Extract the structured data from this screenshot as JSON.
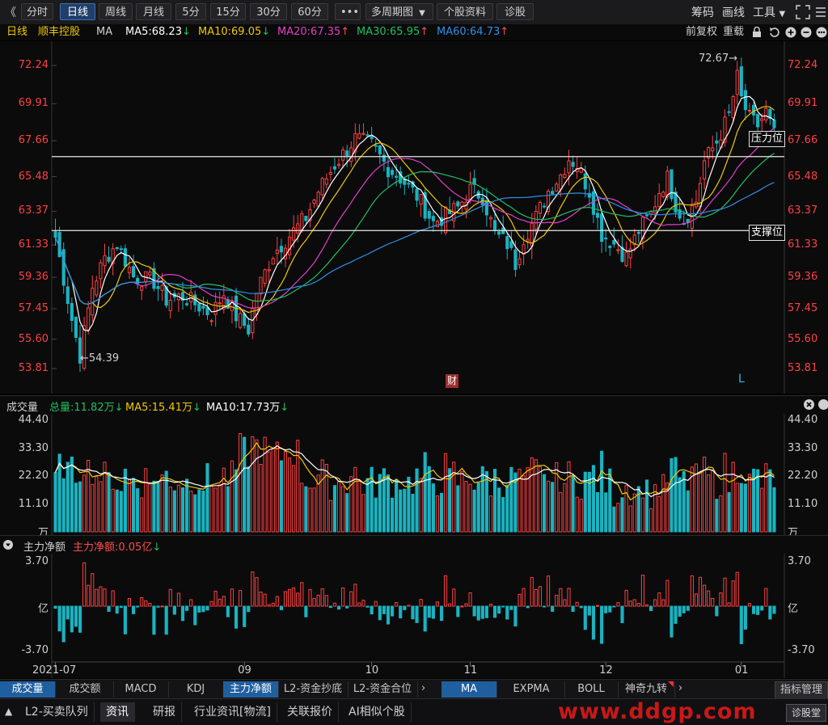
{
  "toolbar": {
    "back_glyph": "《",
    "buttons": [
      "分时",
      "日线",
      "周线",
      "月线",
      "5分",
      "15分",
      "30分",
      "60分",
      "•••",
      "多周期图",
      "个股资料",
      "诊股"
    ],
    "active": "日线",
    "multi_dropdown_glyph": "▼",
    "right": [
      "筹码",
      "画线",
      "工具"
    ],
    "tools_dropdown_glyph": "▼"
  },
  "info": {
    "period": "日线",
    "stock": "顺丰控股",
    "indicator": "MA",
    "ma5": "MA5:68.23",
    "ma10": "MA10:69.05",
    "ma20": "MA20:67.35",
    "ma30": "MA30:65.95",
    "ma60": "MA60:64.73",
    "fuquan": "前复权",
    "reload": "重载"
  },
  "colors": {
    "up": "#ff4040",
    "down": "#1ab3c0",
    "ma5": "#ffffff",
    "ma10": "#f0c800",
    "ma20": "#e040c8",
    "ma30": "#20c060",
    "ma60": "#2f8fe8",
    "grid": "#262626",
    "axis_red": "#ff4040"
  },
  "main": {
    "y_labels": [
      "72.24",
      "69.91",
      "67.66",
      "65.48",
      "63.37",
      "61.33",
      "59.36",
      "57.45",
      "55.60",
      "53.81"
    ],
    "y_range": [
      53.81,
      72.24
    ],
    "high_marker": "72.67→",
    "low_marker": "←54.39",
    "resistance_label": "压力位",
    "support_label": "支撑位",
    "resistance_value": 66.7,
    "support_value": 62.2,
    "cai_badge": "财",
    "l_badge": "L"
  },
  "volume": {
    "title": "成交量",
    "total": "总量:11.82万",
    "ma5": "MA5:15.41万",
    "ma10": "MA10:17.73万",
    "y_labels": [
      "44.40",
      "33.30",
      "22.20",
      "11.10",
      "万"
    ],
    "y_max": 44.4
  },
  "netflow": {
    "title": "主力净额",
    "value": "主力净额:0.05亿",
    "y_labels": [
      "3.70",
      "亿",
      "-3.70"
    ],
    "y_max": 3.7
  },
  "x_labels": [
    {
      "label": "2021-07",
      "bar": 0
    },
    {
      "label": "09",
      "bar": 46
    },
    {
      "label": "10",
      "bar": 77
    },
    {
      "label": "11",
      "bar": 101
    },
    {
      "label": "12",
      "bar": 134
    },
    {
      "label": "01",
      "bar": 167
    }
  ],
  "tabs_indicator": [
    "成交量",
    "成交额",
    "MACD",
    "KDJ",
    "主力净额",
    "L2-资金抄底",
    "L2-资金合位"
  ],
  "tabs_indicator_active": [
    "成交量",
    "主力净额"
  ],
  "tabs_ma": [
    "MA",
    "EXPMA",
    "BOLL",
    "神奇九转"
  ],
  "tabs_ma_active": "MA",
  "indicator_mgmt": "指标管理",
  "tabs_bottom": [
    "L2-买卖队列",
    "资讯",
    "研报",
    "行业资讯[物流]",
    "关联报价",
    "AI相似个股"
  ],
  "tabs_bottom_active": "资讯",
  "watermark": "www.ddgp.com",
  "stock_button": "诊股堂",
  "chart_data": {
    "type": "candlestick",
    "n_bars": 176,
    "anchors": [
      [
        0,
        61.8
      ],
      [
        4,
        56.8
      ],
      [
        6,
        54.6
      ],
      [
        9,
        58.8
      ],
      [
        12,
        60.5
      ],
      [
        15,
        61.4
      ],
      [
        19,
        59.4
      ],
      [
        24,
        59.1
      ],
      [
        27,
        58.0
      ],
      [
        31,
        58.2
      ],
      [
        35,
        57.6
      ],
      [
        38,
        57.1
      ],
      [
        41,
        58.4
      ],
      [
        44,
        57.0
      ],
      [
        47,
        56.2
      ],
      [
        49,
        58.5
      ],
      [
        53,
        60.8
      ],
      [
        57,
        61.9
      ],
      [
        61,
        63.0
      ],
      [
        64,
        64.6
      ],
      [
        68,
        66.2
      ],
      [
        73,
        67.8
      ],
      [
        77,
        67.4
      ],
      [
        81,
        66.0
      ],
      [
        84,
        65.4
      ],
      [
        88,
        64.3
      ],
      [
        92,
        62.7
      ],
      [
        95,
        63.1
      ],
      [
        98,
        63.6
      ],
      [
        101,
        64.7
      ],
      [
        104,
        64.3
      ],
      [
        107,
        62.0
      ],
      [
        110,
        61.4
      ],
      [
        112,
        60.2
      ],
      [
        114,
        61.8
      ],
      [
        117,
        63.0
      ],
      [
        120,
        64.6
      ],
      [
        123,
        65.6
      ],
      [
        125,
        66.6
      ],
      [
        127,
        66.2
      ],
      [
        130,
        64.6
      ],
      [
        133,
        62.0
      ],
      [
        136,
        61.4
      ],
      [
        139,
        60.6
      ],
      [
        142,
        62.2
      ],
      [
        145,
        63.2
      ],
      [
        147,
        64.6
      ],
      [
        149,
        65.4
      ],
      [
        151,
        63.8
      ],
      [
        153,
        62.8
      ],
      [
        156,
        64.0
      ],
      [
        158,
        66.4
      ],
      [
        161,
        67.6
      ],
      [
        164,
        69.2
      ],
      [
        166,
        71.5
      ],
      [
        167,
        70.2
      ],
      [
        169,
        69.0
      ],
      [
        171,
        68.6
      ],
      [
        173,
        69.4
      ],
      [
        175,
        68.0
      ]
    ],
    "volume_note": "volume in 万 (10k shares)",
    "netflow_note": "main net inflow in 亿"
  }
}
